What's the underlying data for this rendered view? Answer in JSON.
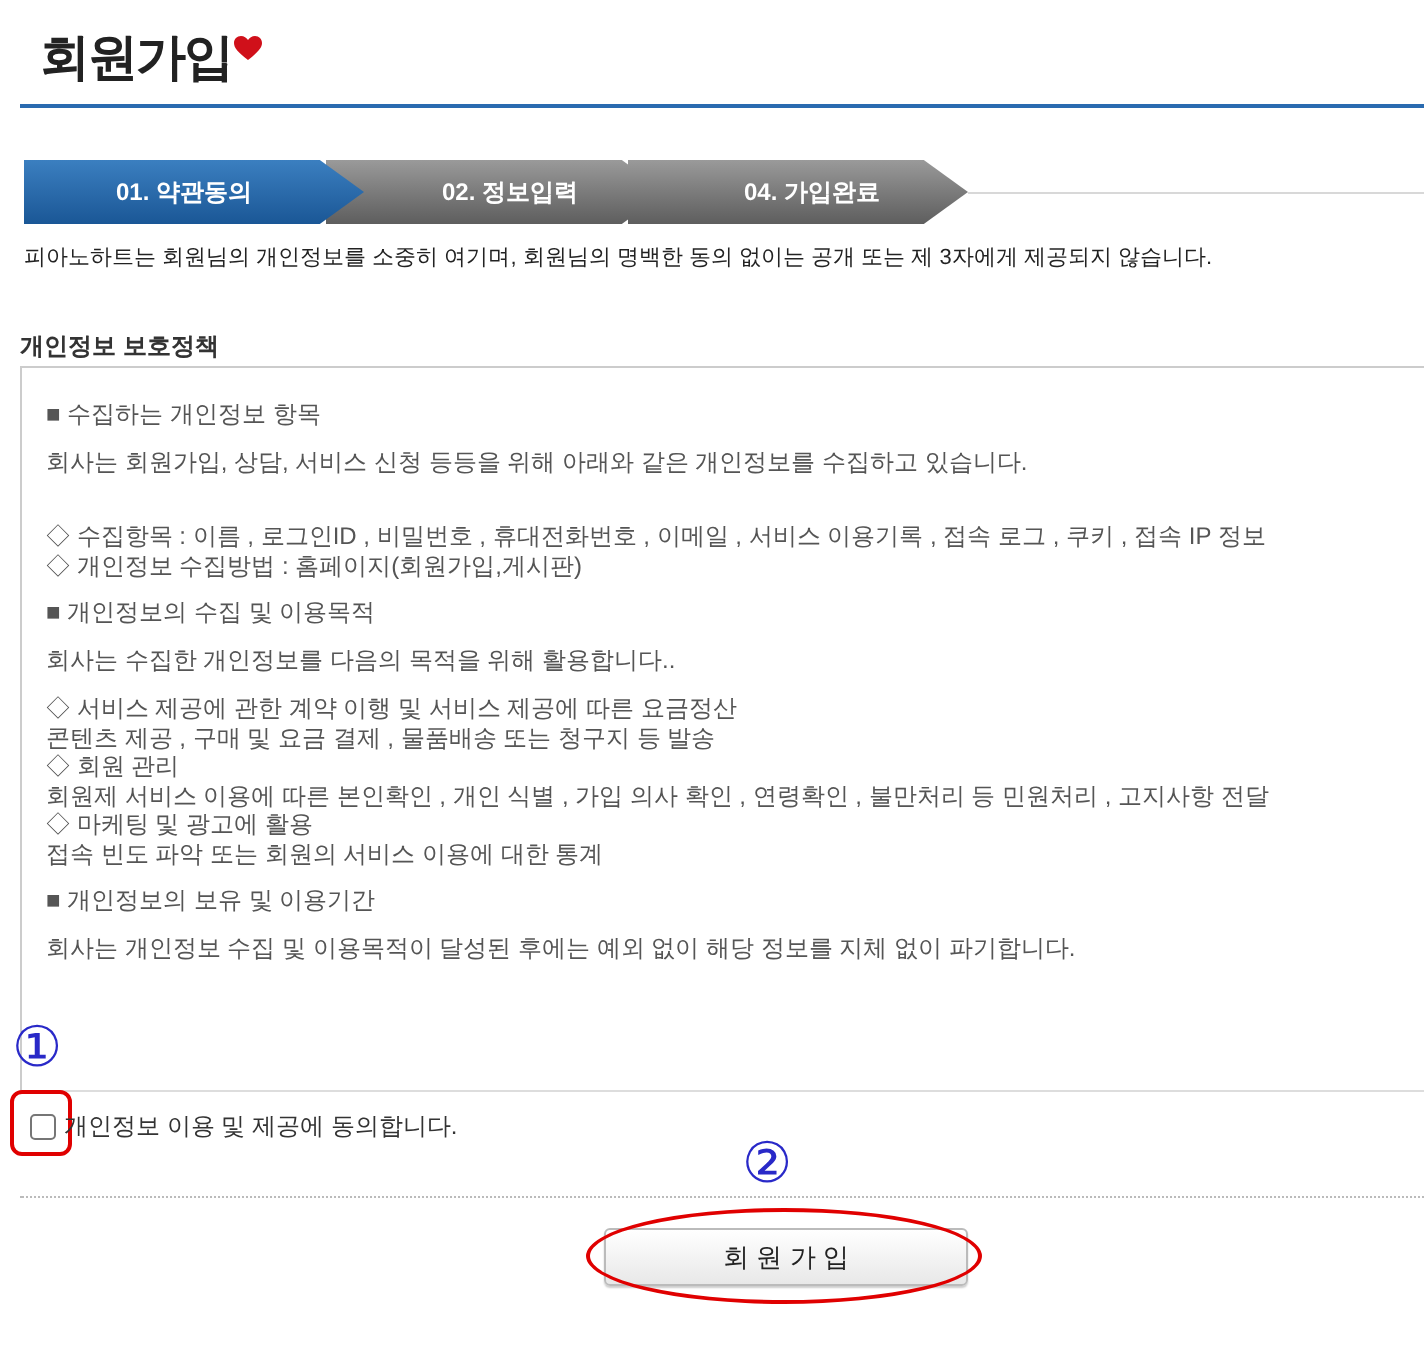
{
  "page_title": "회원가입",
  "steps": [
    {
      "label": "01. 약관동의",
      "selected": true
    },
    {
      "label": "02. 정보입력",
      "selected": false
    },
    {
      "label": "04. 가입완료",
      "selected": false
    }
  ],
  "notice": "피아노하트는 회원님의 개인정보를 소중히 여기며, 회원님의 명백한 동의 없이는 공개 또는 제 3자에게 제공되지 않습니다.",
  "policy": {
    "title": "개인정보 보호정책",
    "blocks": [
      {
        "kind": "heading",
        "text": "■ 수집하는 개인정보 항목"
      },
      {
        "kind": "paragraph",
        "lines": [
          "회사는 회원가입, 상담, 서비스 신청 등등을 위해 아래와 같은 개인정보를 수집하고 있습니다."
        ]
      },
      {
        "kind": "list",
        "lines": [
          "◇ 수집항목 : 이름 , 로그인ID , 비밀번호 , 휴대전화번호 , 이메일 , 서비스 이용기록 , 접속 로그 , 쿠키 , 접속 IP 정보",
          "◇ 개인정보 수집방법 : 홈페이지(회원가입,게시판)"
        ]
      },
      {
        "kind": "heading",
        "text": "■ 개인정보의 수집 및 이용목적"
      },
      {
        "kind": "paragraph",
        "lines": [
          "회사는 수집한 개인정보를 다음의 목적을 위해 활용합니다.."
        ]
      },
      {
        "kind": "list",
        "lines": [
          "◇ 서비스 제공에 관한 계약 이행 및 서비스 제공에 따른 요금정산",
          "콘텐츠 제공 , 구매 및 요금 결제 , 물품배송 또는 청구지 등 발송",
          "◇ 회원 관리",
          "회원제 서비스 이용에 따른 본인확인 , 개인 식별 , 가입 의사 확인 , 연령확인 , 불만처리 등 민원처리 , 고지사항 전달",
          "◇ 마케팅 및 광고에 활용",
          "접속 빈도 파악 또는 회원의 서비스 이용에 대한 통계"
        ]
      },
      {
        "kind": "heading",
        "text": "■ 개인정보의 보유 및 이용기간"
      },
      {
        "kind": "paragraph",
        "lines": [
          "회사는 개인정보 수집 및 이용목적이 달성된 후에는 예외 없이 해당 정보를 지체 없이 파기합니다."
        ]
      }
    ]
  },
  "agree": {
    "label": "개인정보 이용 및 제공에 동의합니다.",
    "checked": false
  },
  "submit_button": "회 원 가 입",
  "annotations": [
    "①",
    "②"
  ]
}
